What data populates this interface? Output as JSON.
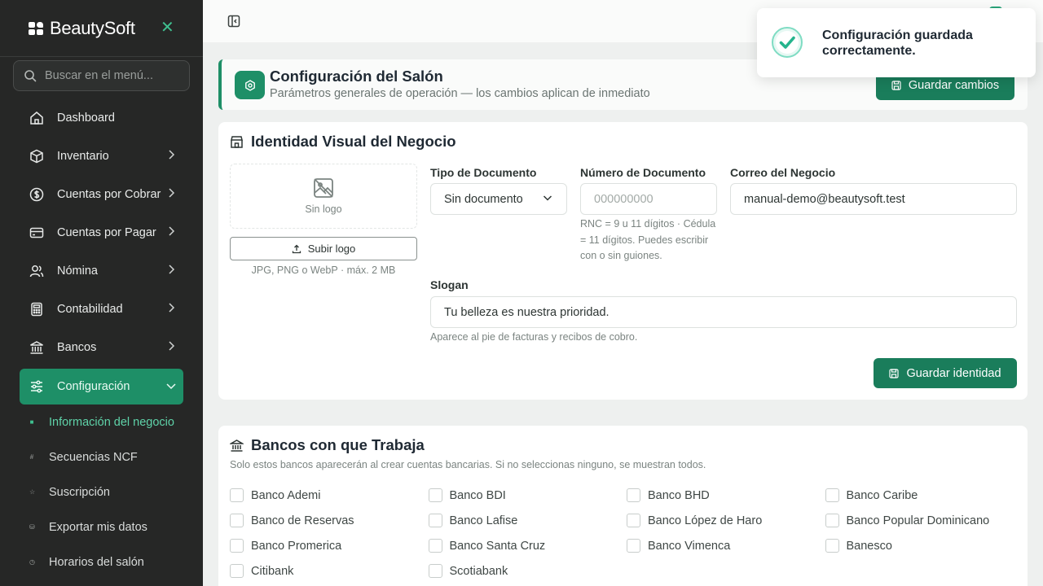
{
  "brand": {
    "name": "BeautySoft"
  },
  "search": {
    "placeholder": "Buscar en el menú..."
  },
  "nav": [
    {
      "label": "Dashboard",
      "icon": "home-icon"
    },
    {
      "label": "Inventario",
      "icon": "box-icon"
    },
    {
      "label": "Cuentas por Cobrar",
      "icon": "dollar-icon"
    },
    {
      "label": "Cuentas por Pagar",
      "icon": "credit-card-icon"
    },
    {
      "label": "Nómina",
      "icon": "users-icon"
    },
    {
      "label": "Contabilidad",
      "icon": "calculator-icon"
    },
    {
      "label": "Bancos",
      "icon": "bank-icon"
    },
    {
      "label": "Configuración",
      "icon": "sliders-icon"
    }
  ],
  "subnav": [
    {
      "label": "Información del negocio"
    },
    {
      "label": "Secuencias NCF"
    },
    {
      "label": "Suscripción"
    },
    {
      "label": "Exportar mis datos"
    },
    {
      "label": "Horarios del salón"
    }
  ],
  "header": {
    "title": "Configuración del Salón",
    "subtitle": "Parámetros generales de operación — los cambios aplican de inmediato",
    "save_label": "Guardar cambios"
  },
  "identity": {
    "title": "Identidad Visual del Negocio",
    "logo_placeholder": "Sin logo",
    "upload_label": "Subir logo",
    "logo_hint": "JPG, PNG o WebP · máx. 2 MB",
    "doc_type_label": "Tipo de Documento",
    "doc_type_value": "Sin documento",
    "doc_number_label": "Número de Documento",
    "doc_number_placeholder": "000000000",
    "doc_number_hint": "RNC = 9 u 11 dígitos · Cédula = 11 dígitos. Puedes escribir con o sin guiones.",
    "email_label": "Correo del Negocio",
    "email_value": "manual-demo@beautysoft.test",
    "slogan_label": "Slogan",
    "slogan_value": "Tu belleza es nuestra prioridad.",
    "slogan_hint": "Aparece al pie de facturas y recibos de cobro.",
    "save_label": "Guardar identidad"
  },
  "banks": {
    "title": "Bancos con que Trabaja",
    "subtitle": "Solo estos bancos aparecerán al crear cuentas bancarias. Si no seleccionas ninguno, se muestran todos.",
    "items": [
      {
        "label": "Banco Ademi",
        "checked": false
      },
      {
        "label": "Banco BDI",
        "checked": false
      },
      {
        "label": "Banco BHD",
        "checked": false
      },
      {
        "label": "Banco Caribe",
        "checked": false
      },
      {
        "label": "Banco de Reservas",
        "checked": false
      },
      {
        "label": "Banco Lafise",
        "checked": false
      },
      {
        "label": "Banco López de Haro",
        "checked": false
      },
      {
        "label": "Banco Popular Dominicano",
        "checked": false
      },
      {
        "label": "Banco Promerica",
        "checked": false
      },
      {
        "label": "Banco Santa Cruz",
        "checked": false
      },
      {
        "label": "Banco Vimenca",
        "checked": false
      },
      {
        "label": "Banesco",
        "checked": false
      },
      {
        "label": "Citibank",
        "checked": false
      },
      {
        "label": "Scotiabank",
        "checked": false
      }
    ]
  },
  "toast": {
    "message": "Configuración guardada correctamente."
  },
  "colors": {
    "accent": "#1e8f67",
    "sidebar": "#262726",
    "success": "#2cc9a0"
  }
}
